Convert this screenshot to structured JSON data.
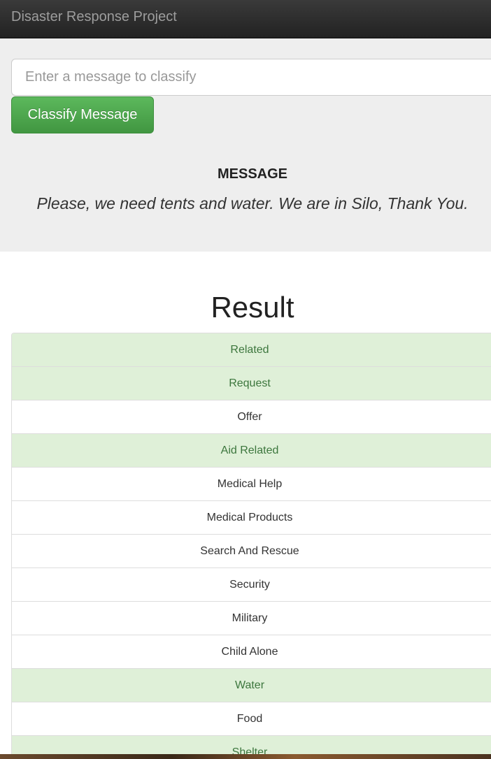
{
  "navbar": {
    "brand": "Disaster Response Project"
  },
  "form": {
    "placeholder": "Enter a message to classify",
    "button_label": "Classify Message"
  },
  "message": {
    "heading": "MESSAGE",
    "text": "Please, we need tents and water. We are in Silo, Thank You."
  },
  "result": {
    "title": "Result",
    "categories": [
      {
        "label": "Related",
        "positive": true
      },
      {
        "label": "Request",
        "positive": true
      },
      {
        "label": "Offer",
        "positive": false
      },
      {
        "label": "Aid Related",
        "positive": true
      },
      {
        "label": "Medical Help",
        "positive": false
      },
      {
        "label": "Medical Products",
        "positive": false
      },
      {
        "label": "Search And Rescue",
        "positive": false
      },
      {
        "label": "Security",
        "positive": false
      },
      {
        "label": "Military",
        "positive": false
      },
      {
        "label": "Child Alone",
        "positive": false
      },
      {
        "label": "Water",
        "positive": true
      },
      {
        "label": "Food",
        "positive": false
      },
      {
        "label": "Shelter",
        "positive": true
      }
    ]
  },
  "colors": {
    "positive_bg": "#dff0d8",
    "positive_text": "#3c763d",
    "button_green": "#5cb85c",
    "navbar_bg": "#222222"
  }
}
